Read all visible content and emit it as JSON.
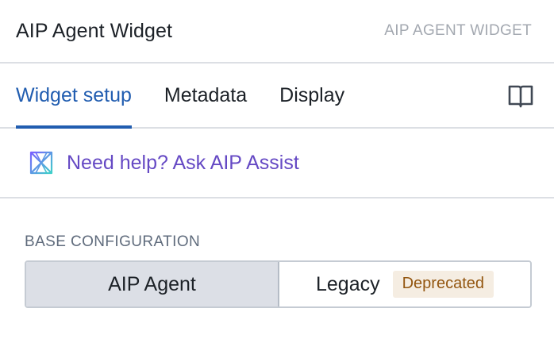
{
  "header": {
    "title": "AIP Agent Widget",
    "type_label": "AIP AGENT WIDGET"
  },
  "tabs": [
    {
      "label": "Widget setup",
      "active": true
    },
    {
      "label": "Metadata",
      "active": false
    },
    {
      "label": "Display",
      "active": false
    }
  ],
  "docs_icon": "book-open-icon",
  "help": {
    "icon": "aip-assist-icon",
    "text": "Need help? Ask AIP Assist"
  },
  "base_configuration": {
    "label": "BASE CONFIGURATION",
    "options": [
      {
        "label": "AIP Agent",
        "selected": true
      },
      {
        "label": "Legacy",
        "selected": false,
        "tag": "Deprecated"
      }
    ]
  },
  "colors": {
    "accent": "#215db0",
    "assist": "#6549c4",
    "tag_bg": "#f5ede2",
    "tag_text": "#935610"
  }
}
